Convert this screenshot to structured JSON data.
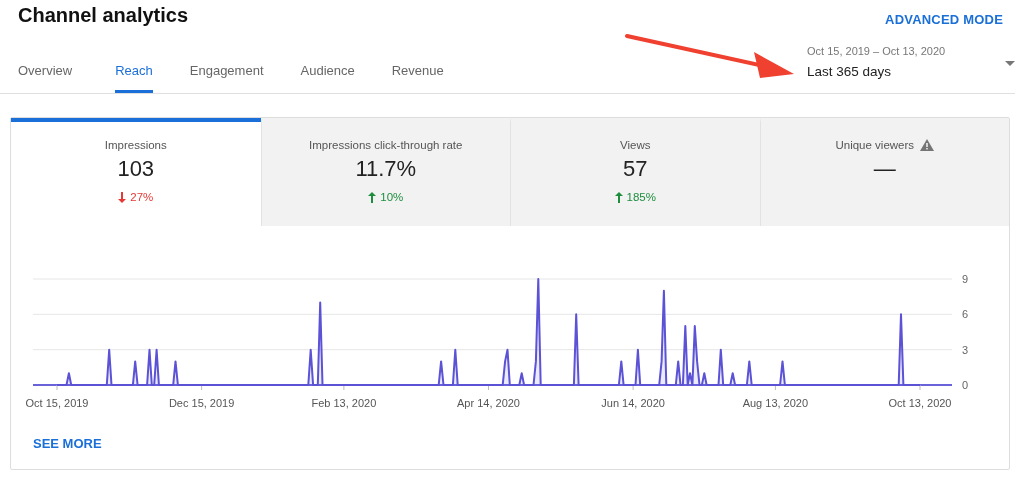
{
  "header": {
    "title": "Channel analytics",
    "mode_link": "ADVANCED MODE"
  },
  "tabs": [
    {
      "label": "Overview",
      "selected": false
    },
    {
      "label": "Reach",
      "selected": true
    },
    {
      "label": "Engagement",
      "selected": false
    },
    {
      "label": "Audience",
      "selected": false
    },
    {
      "label": "Revenue",
      "selected": false
    }
  ],
  "date_range": {
    "range": "Oct 15, 2019 – Oct 13, 2020",
    "value": "Last 365 days"
  },
  "metrics": [
    {
      "label": "Impressions",
      "value": "103",
      "change": "27%",
      "increase": false,
      "selected": true,
      "warning": false
    },
    {
      "label": "Impressions click-through rate",
      "value": "11.7%",
      "change": "10%",
      "increase": true,
      "selected": false,
      "warning": false
    },
    {
      "label": "Views",
      "value": "57",
      "change": "185%",
      "increase": true,
      "selected": false,
      "warning": false
    },
    {
      "label": "Unique viewers",
      "value": "—",
      "selected": false,
      "warning": true
    }
  ],
  "chart_data": {
    "type": "area",
    "ylim": [
      0,
      9
    ],
    "yticks": [
      0,
      3,
      6,
      9
    ],
    "categories": [
      "Oct 15, 2019",
      null,
      null,
      null,
      null,
      null,
      null,
      null,
      null,
      null,
      null,
      null,
      null,
      null,
      null,
      null,
      null,
      null,
      null,
      null,
      null,
      null,
      null,
      null,
      null,
      null,
      null,
      null,
      null,
      null,
      null,
      null,
      null,
      null,
      null,
      null,
      null,
      null,
      null,
      null,
      null,
      null,
      null,
      null,
      null,
      null,
      null,
      null,
      null,
      null,
      null,
      null,
      null,
      null,
      null,
      null,
      null,
      null,
      null,
      null,
      null,
      "Dec 15, 2019",
      null,
      null,
      null,
      null,
      null,
      null,
      null,
      null,
      null,
      null,
      null,
      null,
      null,
      null,
      null,
      null,
      null,
      null,
      null,
      null,
      null,
      null,
      null,
      null,
      null,
      null,
      null,
      null,
      null,
      null,
      null,
      null,
      null,
      null,
      null,
      null,
      null,
      null,
      null,
      null,
      null,
      null,
      null,
      null,
      null,
      null,
      null,
      null,
      null,
      null,
      null,
      null,
      null,
      null,
      null,
      null,
      null,
      null,
      null,
      "Feb 13, 2020",
      null,
      null,
      null,
      null,
      null,
      null,
      null,
      null,
      null,
      null,
      null,
      null,
      null,
      null,
      null,
      null,
      null,
      null,
      null,
      null,
      null,
      null,
      null,
      null,
      null,
      null,
      null,
      null,
      null,
      null,
      null,
      null,
      null,
      null,
      null,
      null,
      null,
      null,
      null,
      null,
      null,
      null,
      null,
      null,
      null,
      null,
      null,
      null,
      null,
      null,
      null,
      null,
      null,
      null,
      null,
      null,
      null,
      null,
      null,
      null,
      "Apr 14, 2020",
      null,
      null,
      null,
      null,
      null,
      null,
      null,
      null,
      null,
      null,
      null,
      null,
      null,
      null,
      null,
      null,
      null,
      null,
      null,
      null,
      null,
      null,
      null,
      null,
      null,
      null,
      null,
      null,
      null,
      null,
      null,
      null,
      null,
      null,
      null,
      null,
      null,
      null,
      null,
      null,
      null,
      null,
      null,
      null,
      null,
      null,
      null,
      null,
      null,
      null,
      null,
      null,
      null,
      null,
      null,
      null,
      null,
      null,
      null,
      null,
      "Jun 14, 2020",
      null,
      null,
      null,
      null,
      null,
      null,
      null,
      null,
      null,
      null,
      null,
      null,
      null,
      null,
      null,
      null,
      null,
      null,
      null,
      null,
      null,
      null,
      null,
      null,
      null,
      null,
      null,
      null,
      null,
      null,
      null,
      null,
      null,
      null,
      null,
      null,
      null,
      null,
      null,
      null,
      null,
      null,
      null,
      null,
      null,
      null,
      null,
      null,
      null,
      null,
      null,
      null,
      null,
      null,
      null,
      null,
      null,
      null,
      null,
      "Aug 13, 2020",
      null,
      null,
      null,
      null,
      null,
      null,
      null,
      null,
      null,
      null,
      null,
      null,
      null,
      null,
      null,
      null,
      null,
      null,
      null,
      null,
      null,
      null,
      null,
      null,
      null,
      null,
      null,
      null,
      null,
      null,
      null,
      null,
      null,
      null,
      null,
      null,
      null,
      null,
      null,
      null,
      null,
      null,
      null,
      null,
      null,
      null,
      null,
      null,
      null,
      null,
      null,
      null,
      null,
      null,
      null,
      null,
      null,
      null,
      null,
      null,
      "Oct 13, 2020"
    ],
    "series": [
      {
        "color": "#5b52d6",
        "values": [
          0,
          0,
          0,
          0,
          0,
          1,
          0,
          0,
          0,
          0,
          0,
          0,
          0,
          0,
          0,
          0,
          0,
          0,
          0,
          0,
          0,
          0,
          3,
          0,
          0,
          0,
          0,
          0,
          0,
          0,
          0,
          0,
          0,
          2,
          0,
          0,
          0,
          0,
          0,
          3,
          0,
          0,
          3,
          0,
          0,
          0,
          0,
          0,
          0,
          0,
          2,
          0,
          0,
          0,
          0,
          0,
          0,
          0,
          0,
          0,
          0,
          0,
          0,
          0,
          0,
          0,
          0,
          0,
          0,
          0,
          0,
          0,
          0,
          0,
          0,
          0,
          0,
          0,
          0,
          0,
          0,
          0,
          0,
          0,
          0,
          0,
          0,
          0,
          0,
          0,
          0,
          0,
          0,
          0,
          0,
          0,
          0,
          0,
          0,
          0,
          0,
          0,
          0,
          0,
          0,
          0,
          0,
          3,
          0,
          0,
          0,
          7,
          0,
          0,
          0,
          0,
          0,
          0,
          0,
          0,
          0,
          0,
          0,
          0,
          0,
          0,
          0,
          0,
          0,
          0,
          0,
          0,
          0,
          0,
          0,
          0,
          0,
          0,
          0,
          0,
          0,
          0,
          0,
          0,
          0,
          0,
          0,
          0,
          0,
          0,
          0,
          0,
          0,
          0,
          0,
          0,
          0,
          0,
          0,
          0,
          0,
          0,
          2,
          0,
          0,
          0,
          0,
          0,
          3,
          0,
          0,
          0,
          0,
          0,
          0,
          0,
          0,
          0,
          0,
          0,
          0,
          0,
          0,
          0,
          0,
          0,
          0,
          0,
          0,
          2,
          3,
          0,
          0,
          0,
          0,
          0,
          1,
          0,
          0,
          0,
          0,
          0,
          2,
          9,
          0,
          0,
          0,
          0,
          0,
          0,
          0,
          0,
          0,
          0,
          0,
          0,
          0,
          0,
          0,
          6,
          0,
          0,
          0,
          0,
          0,
          0,
          0,
          0,
          0,
          0,
          0,
          0,
          0,
          0,
          0,
          0,
          0,
          0,
          2,
          0,
          0,
          0,
          0,
          0,
          0,
          3,
          0,
          0,
          0,
          0,
          0,
          0,
          0,
          0,
          0,
          2,
          8,
          0,
          0,
          0,
          0,
          0,
          2,
          0,
          0,
          5,
          0,
          1,
          0,
          5,
          2,
          0,
          0,
          1,
          0,
          0,
          0,
          0,
          0,
          0,
          3,
          0,
          0,
          0,
          0,
          1,
          0,
          0,
          0,
          0,
          0,
          0,
          2,
          0,
          0,
          0,
          0,
          0,
          0,
          0,
          0,
          0,
          0,
          0,
          0,
          0,
          2,
          0,
          0,
          0,
          0,
          0,
          0,
          0,
          0,
          0,
          0,
          0,
          0,
          0,
          0,
          0,
          0,
          0,
          0,
          0,
          0,
          0,
          0,
          0,
          0,
          0,
          0,
          0,
          0,
          0,
          0,
          0,
          0,
          0,
          0,
          0,
          0,
          0,
          0,
          0,
          0,
          0,
          0,
          0,
          0,
          0,
          0,
          0,
          0,
          0,
          6,
          0,
          0,
          0,
          0,
          0,
          0,
          0,
          0
        ]
      }
    ]
  },
  "see_more": "SEE MORE"
}
